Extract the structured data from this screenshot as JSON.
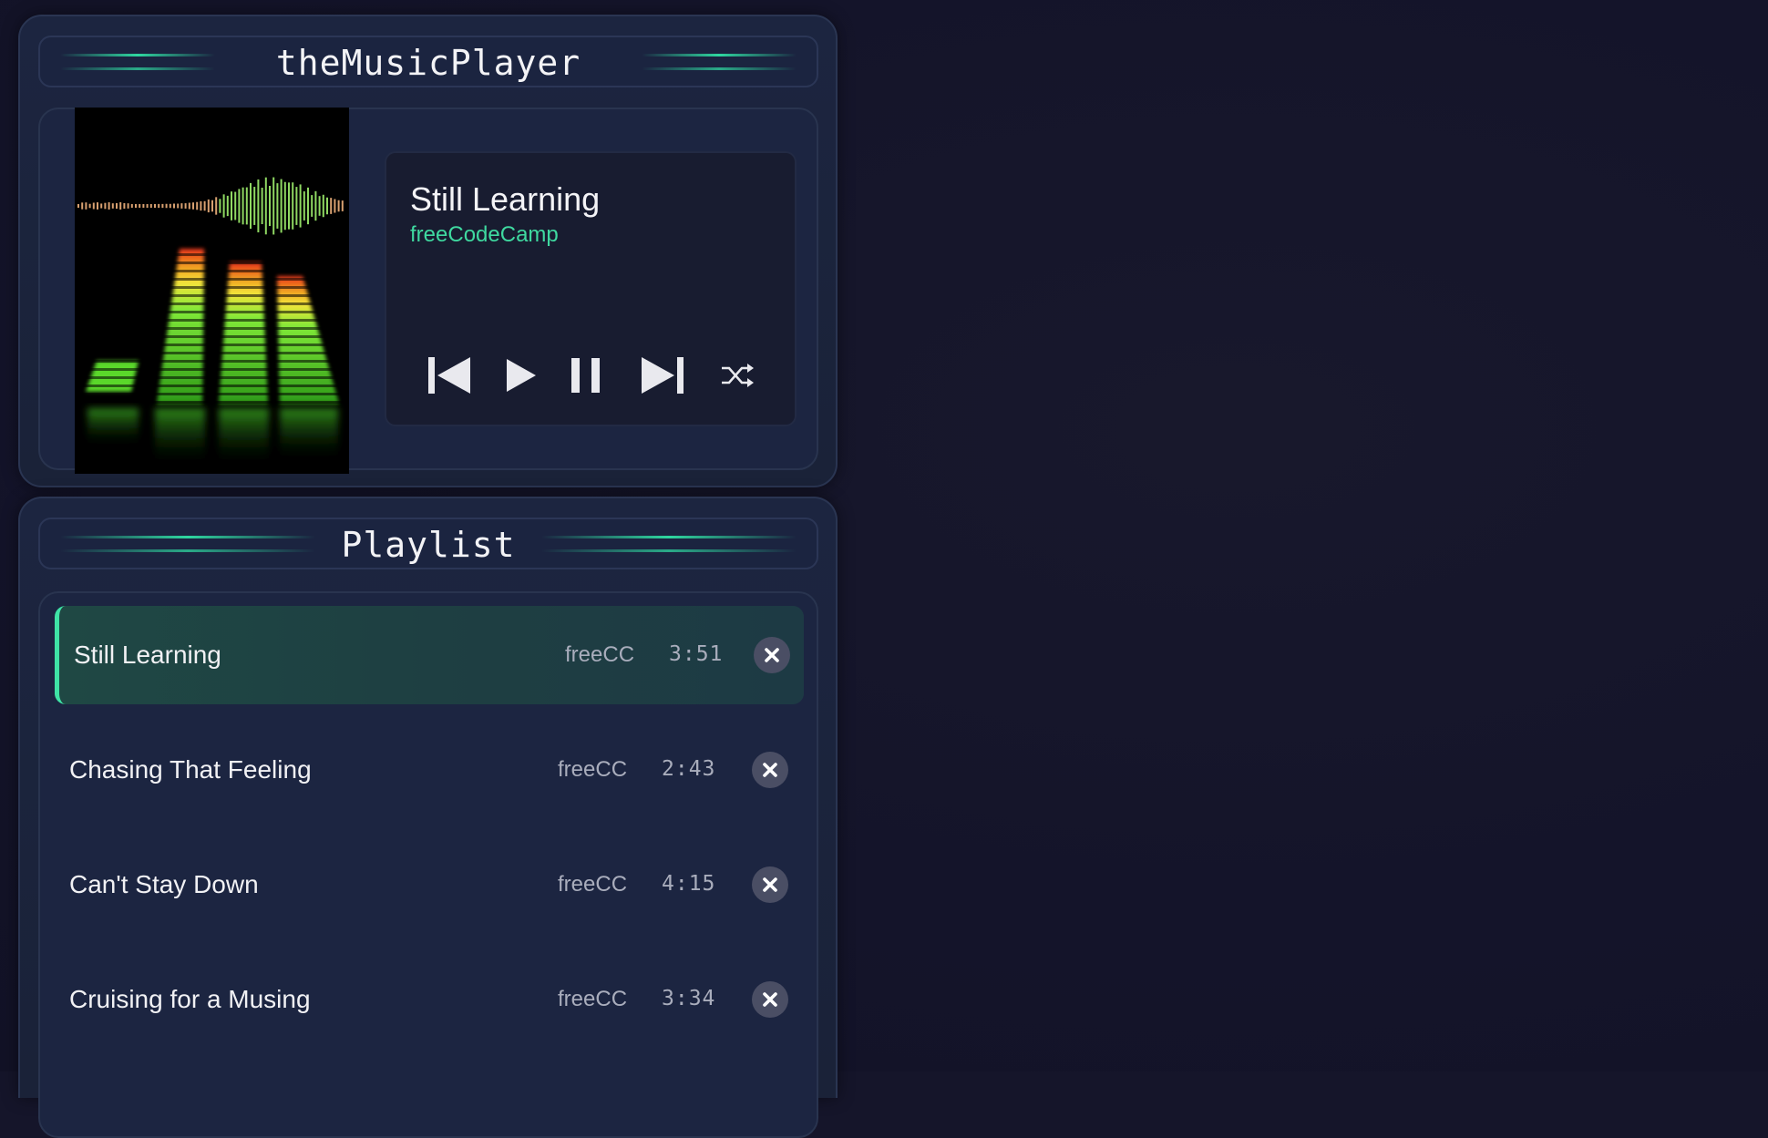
{
  "app": {
    "title": "theMusicPlayer"
  },
  "now_playing": {
    "title": "Still Learning",
    "artist": "freeCodeCamp"
  },
  "controls": {
    "icons": [
      "previous-icon",
      "play-icon",
      "pause-icon",
      "next-icon",
      "shuffle-icon"
    ]
  },
  "playlist": {
    "title": "Playlist",
    "items": [
      {
        "title": "Still Learning",
        "artist": "freeCC",
        "duration": "3:51",
        "active": true
      },
      {
        "title": "Chasing That Feeling",
        "artist": "freeCC",
        "duration": "2:43",
        "active": false
      },
      {
        "title": "Can't Stay Down",
        "artist": "freeCC",
        "duration": "4:15",
        "active": false
      },
      {
        "title": "Cruising for a Musing",
        "artist": "freeCC",
        "duration": "3:34",
        "active": false
      }
    ]
  },
  "colors": {
    "accent": "#3fd9a0",
    "panel": "#1c2541",
    "background": "#14142a"
  }
}
